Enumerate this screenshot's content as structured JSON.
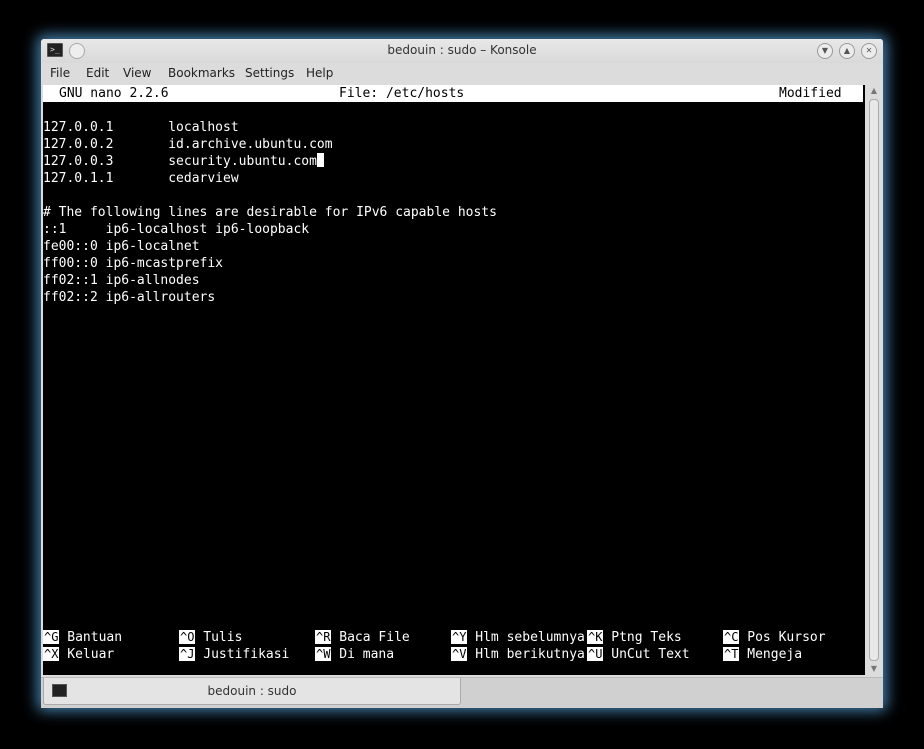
{
  "window": {
    "title": "bedouin : sudo – Konsole",
    "terminal_icon_glyph": ">_"
  },
  "menu": [
    {
      "label": "File"
    },
    {
      "label": "Edit"
    },
    {
      "label": "View"
    },
    {
      "label": "Bookmarks"
    },
    {
      "label": "Settings"
    },
    {
      "label": "Help"
    }
  ],
  "nano": {
    "version": "GNU nano 2.2.6",
    "file": "File: /etc/hosts",
    "status": "Modified",
    "lines": [
      "",
      "127.0.0.1       localhost",
      "127.0.0.2       id.archive.ubuntu.com",
      "127.0.0.3       security.ubuntu.com",
      "127.0.1.1       cedarview",
      "",
      "# The following lines are desirable for IPv6 capable hosts",
      "::1     ip6-localhost ip6-loopback",
      "fe00::0 ip6-localnet",
      "ff00::0 ip6-mcastprefix",
      "ff02::1 ip6-allnodes",
      "ff02::2 ip6-allrouters"
    ],
    "shortcuts_row1": [
      {
        "key": "^G",
        "label": "Bantuan"
      },
      {
        "key": "^O",
        "label": "Tulis"
      },
      {
        "key": "^R",
        "label": "Baca File"
      },
      {
        "key": "^Y",
        "label": "Hlm sebelumnya"
      },
      {
        "key": "^K",
        "label": "Ptng Teks"
      },
      {
        "key": "^C",
        "label": "Pos Kursor"
      }
    ],
    "shortcuts_row2": [
      {
        "key": "^X",
        "label": "Keluar"
      },
      {
        "key": "^J",
        "label": "Justifikasi"
      },
      {
        "key": "^W",
        "label": "Di mana"
      },
      {
        "key": "^V",
        "label": "Hlm berikutnya"
      },
      {
        "key": "^U",
        "label": "UnCut Text"
      },
      {
        "key": "^T",
        "label": "Mengeja"
      }
    ]
  },
  "tab": {
    "label": "bedouin : sudo"
  },
  "colors": {
    "glow": "#5aaae6",
    "terminal_bg": "#000000",
    "terminal_fg": "#ffffff",
    "chrome": "#dcdcdc"
  }
}
